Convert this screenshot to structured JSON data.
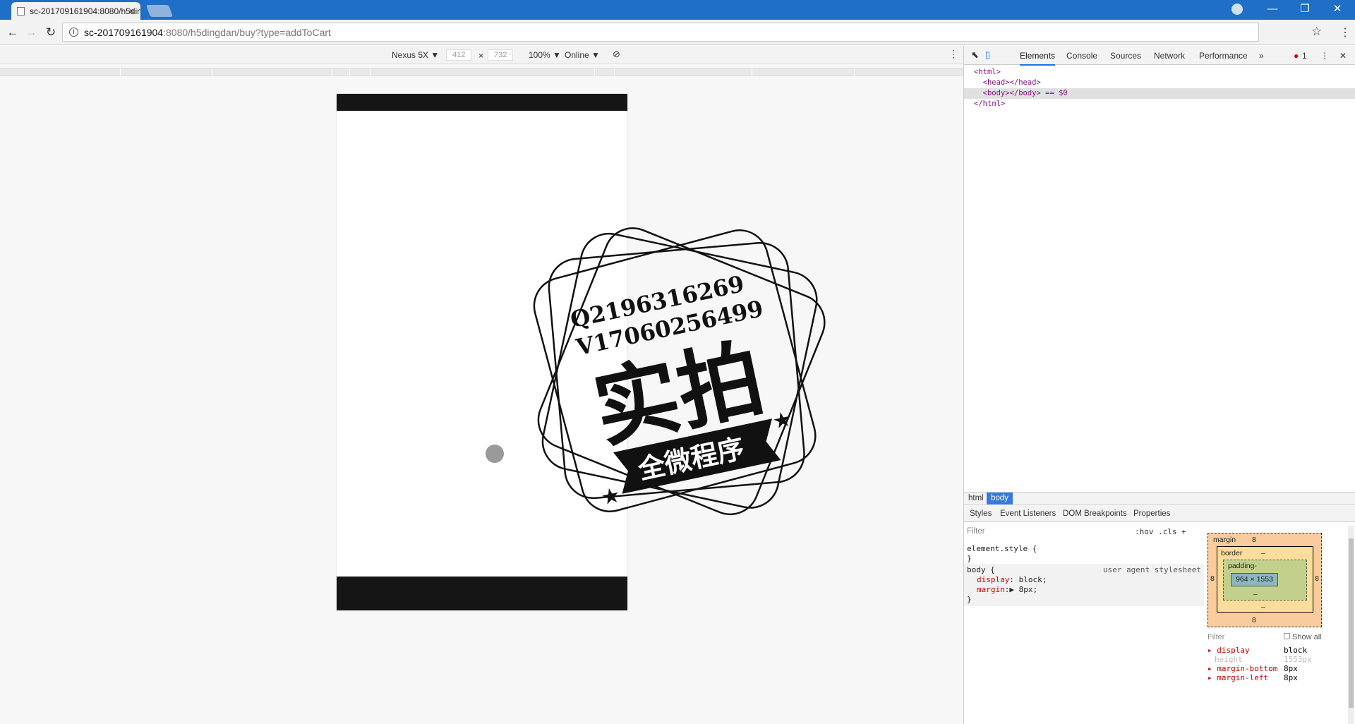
{
  "browser": {
    "tab_title": "sc-201709161904:8080/h5dingd",
    "tab_close": "×",
    "url_host": "sc-201709161904",
    "url_rest": ":8080/h5dingdan/buy?type=addToCart"
  },
  "device_toolbar": {
    "device": "Nexus 5X ▼",
    "width": "412",
    "x": "×",
    "height": "732",
    "zoom": "100% ▼",
    "network": "Online ▼"
  },
  "stamp": {
    "line1": "Q2196316269",
    "line2": "V17060256499",
    "title": "实拍",
    "ribbon": "全微程序"
  },
  "devtools": {
    "tabs": [
      "Elements",
      "Console",
      "Sources",
      "Network",
      "Performance"
    ],
    "more": "»",
    "error_count": "1",
    "dom": {
      "l1": "<html>",
      "l2": "  <head></head>",
      "l3": "  <body></body> == $0",
      "l4": "</html>"
    },
    "breadcrumbs": [
      "html",
      "body"
    ],
    "subtabs": [
      "Styles",
      "Event Listeners",
      "DOM Breakpoints",
      "Properties"
    ],
    "styles": {
      "filter": "Filter",
      "hov": ":hov  .cls  +",
      "element_style": "element.style {",
      "close": "}",
      "body_sel": "body {",
      "ua": "user agent stylesheet",
      "p1_name": "display",
      "p1_val": ": block;",
      "p2_name": "margin",
      "p2_val": ":▶ 8px;"
    },
    "box_model": {
      "margin": "margin",
      "margin_val": "8",
      "border": "border",
      "border_val": "–",
      "padding": "padding-",
      "content": "964 × 1553",
      "dash": "–",
      "left": "8",
      "right": "8"
    },
    "computed": {
      "filter": "Filter",
      "show_all": "Show all",
      "rows": [
        {
          "name": "display",
          "value": "block"
        },
        {
          "name": "height",
          "value": "1553px"
        },
        {
          "name": "margin-bottom",
          "value": "8px"
        },
        {
          "name": "margin-left",
          "value": "8px"
        }
      ]
    }
  }
}
